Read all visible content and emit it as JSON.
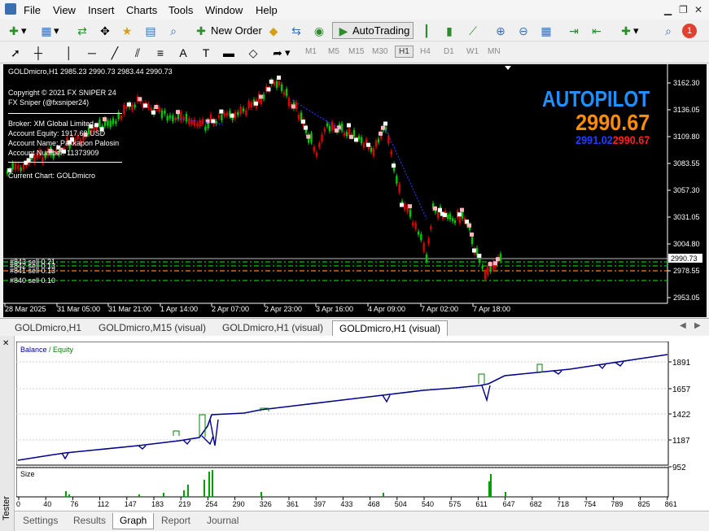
{
  "menu": [
    "File",
    "View",
    "Insert",
    "Charts",
    "Tools",
    "Window",
    "Help"
  ],
  "toolbar": {
    "new_order": "New Order",
    "autotrading": "AutoTrading",
    "notification_count": "1"
  },
  "timeframes": [
    "M1",
    "M5",
    "M15",
    "M30",
    "H1",
    "H4",
    "D1",
    "W1",
    "MN"
  ],
  "active_timeframe": "H1",
  "chart": {
    "header": "GOLDmicro,H1  2985.23 2990.73 2983.44 2990.73",
    "info": [
      "Copyright © 2021 FX SNIPER 24",
      "FX Sniper (@fxsniper24)",
      "Broker: XM Global Limited",
      "Account Equity: 1917.68 USD",
      "Account Name: Pakkapon Palosin",
      "Account Number: 11373909",
      "Current Chart: GOLDmicro"
    ],
    "autopilot": {
      "title": "AUTOPILOT",
      "price": "2990.67",
      "ask": "2991.02",
      "bid": "2990.67"
    },
    "price_axis": [
      "3162.30",
      "3136.05",
      "3109.80",
      "3083.55",
      "3057.30",
      "3031.05",
      "3004.80",
      "2978.55",
      "2953.05"
    ],
    "current_price": "2990.73",
    "time_axis": [
      "28 Mar 2025",
      "31 Mar 05:00",
      "31 Mar 21:00",
      "1 Apr 14:00",
      "2 Apr 07:00",
      "2 Apr 23:00",
      "3 Apr 16:00",
      "4 Apr 09:00",
      "7 Apr 02:00",
      "7 Apr 18:00"
    ],
    "orders": [
      "#843 sell 0.21",
      "#842 sell 0.13",
      "#841 sell 0.13",
      "#840 sell 0.10"
    ],
    "colors": {
      "bull": "#00c800",
      "bear": "#e00000",
      "sell_line": "#00c800",
      "avg_line": "#ff8000",
      "autopilot_title": "#1e90ff",
      "autopilot_price": "#ff8c00"
    }
  },
  "chart_tabs": [
    "GOLDmicro,H1",
    "GOLDmicro,M15 (visual)",
    "GOLDmicro,H1 (visual)",
    "GOLDmicro,H1 (visual)"
  ],
  "active_chart_tab": 3,
  "tester": {
    "side_label": "Tester",
    "legend_balance": "Balance",
    "legend_equity": "Equity",
    "y_axis": [
      "1891",
      "1657",
      "1422",
      "1187",
      "952"
    ],
    "size_label": "Size",
    "x_axis": [
      "0",
      "40",
      "76",
      "112",
      "147",
      "183",
      "219",
      "254",
      "290",
      "326",
      "361",
      "397",
      "433",
      "468",
      "504",
      "540",
      "575",
      "611",
      "647",
      "682",
      "718",
      "754",
      "789",
      "825",
      "861"
    ],
    "tabs": [
      "Settings",
      "Results",
      "Graph",
      "Report",
      "Journal"
    ],
    "active_tab": "Graph",
    "balance_color": "#00008b",
    "equity_color": "#008000"
  }
}
